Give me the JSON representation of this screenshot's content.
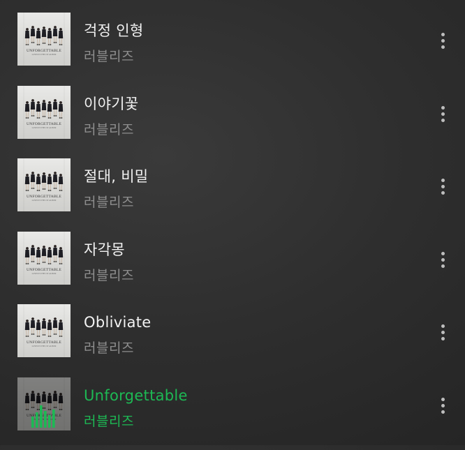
{
  "theme": {
    "accent": "#1db954"
  },
  "album_art": {
    "caption": "UNFORGETTABLE",
    "caption_sub": "LOVELYZ THE 1ST ALBUM"
  },
  "tracks": [
    {
      "title": "걱정 인형",
      "artist": "러블리즈",
      "playing": false,
      "more_icon": "more-vertical-icon"
    },
    {
      "title": "이야기꽃",
      "artist": "러블리즈",
      "playing": false,
      "more_icon": "more-vertical-icon"
    },
    {
      "title": "절대, 비밀",
      "artist": "러블리즈",
      "playing": false,
      "more_icon": "more-vertical-icon"
    },
    {
      "title": "자각몽",
      "artist": "러블리즈",
      "playing": false,
      "more_icon": "more-vertical-icon"
    },
    {
      "title": "Obliviate",
      "artist": "러블리즈",
      "playing": false,
      "more_icon": "more-vertical-icon"
    },
    {
      "title": "Unforgettable",
      "artist": "러블리즈",
      "playing": true,
      "now_playing_icon": "equalizer-icon",
      "more_icon": "more-vertical-icon"
    }
  ]
}
